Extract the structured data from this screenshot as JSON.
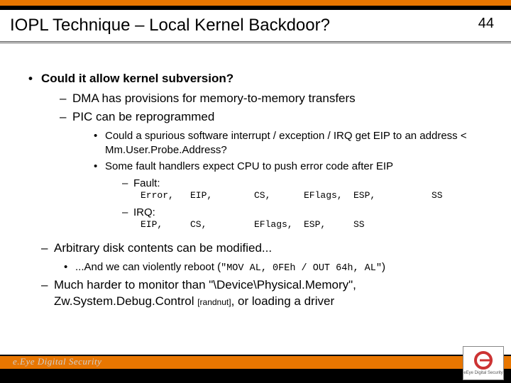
{
  "page_number": "44",
  "title": "IOPL Technique – Local Kernel Backdoor?",
  "b1": "Could it allow kernel subversion?",
  "b1_1": "DMA has provisions for memory-to-memory transfers",
  "b1_2": "PIC can be reprogrammed",
  "b1_2_1": "Could a spurious software interrupt / exception / IRQ get EIP to an address < Mm.User.Probe.Address?",
  "b1_2_2": "Some fault handlers expect CPU to push error code after EIP",
  "fault_label": "Fault:",
  "irq_label": "IRQ:",
  "reg": {
    "r1c1": "Error,",
    "r1c2": "EIP,",
    "r1c3": "CS,",
    "r1c4": "EFlags,",
    "r1c5": "ESP,",
    "r1c6": "SS",
    "r2c1": "EIP,",
    "r2c2": "CS,",
    "r2c3": "EFlags,",
    "r2c4": "ESP,",
    "r2c5": "SS",
    "r2c6": ""
  },
  "b2": "Arbitrary disk contents can be modified...",
  "b2_1_pre": "...And we can violently reboot (",
  "b2_1_code": "\"MOV AL, 0FEh / OUT 64h, AL\"",
  "b2_1_post": ")",
  "b3_pre": "Much harder to monitor than \"\\Device\\Physical.Memory\", Zw.System.Debug.Control ",
  "b3_ref": "[randnut]",
  "b3_post": ", or loading a driver",
  "brand": "e.Eye Digital Security",
  "logo_sub": "eEye Digital Security"
}
